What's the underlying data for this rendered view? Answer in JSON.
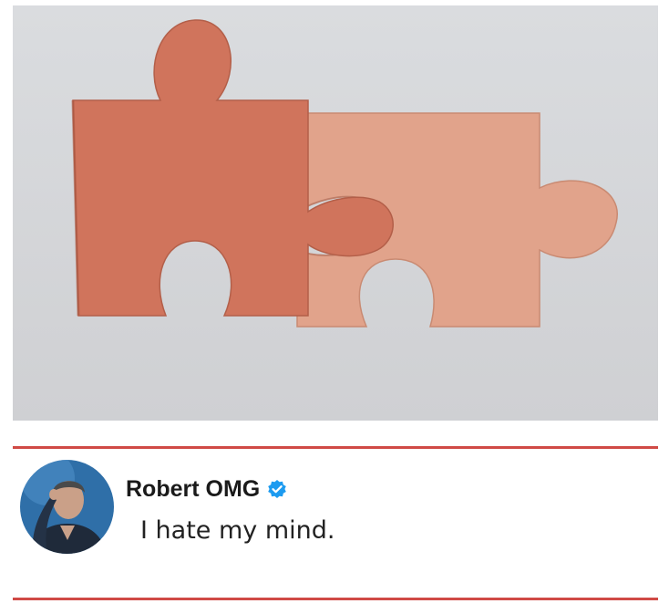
{
  "photo": {
    "subject": "two interlocking jigsaw puzzle pieces",
    "colors": {
      "background": "#dcdcde",
      "left_piece": "#d2775f",
      "right_piece": "#e2a48c"
    }
  },
  "post": {
    "author_name": "Robert OMG",
    "text": "I hate my mind.",
    "verified_icon": "verified-badge-icon",
    "accent_color": "#d04a46",
    "badge_color": "#1d9bf0"
  }
}
